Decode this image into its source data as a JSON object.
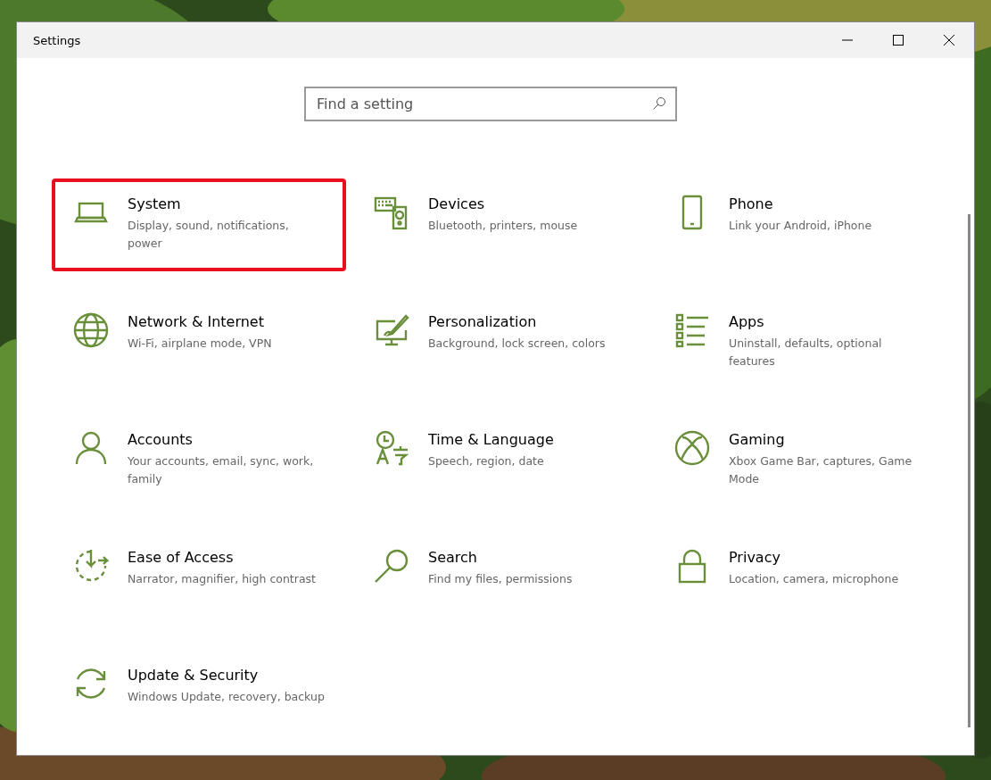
{
  "window": {
    "title": "Settings"
  },
  "search": {
    "placeholder": "Find a setting"
  },
  "tiles": [
    {
      "title": "System",
      "description": "Display, sound, notifications, power",
      "highlighted": true
    },
    {
      "title": "Devices",
      "description": "Bluetooth, printers, mouse",
      "highlighted": false
    },
    {
      "title": "Phone",
      "description": "Link your Android, iPhone",
      "highlighted": false
    },
    {
      "title": "Network & Internet",
      "description": "Wi-Fi, airplane mode, VPN",
      "highlighted": false
    },
    {
      "title": "Personalization",
      "description": "Background, lock screen, colors",
      "highlighted": false
    },
    {
      "title": "Apps",
      "description": "Uninstall, defaults, optional features",
      "highlighted": false
    },
    {
      "title": "Accounts",
      "description": "Your accounts, email, sync, work, family",
      "highlighted": false
    },
    {
      "title": "Time & Language",
      "description": "Speech, region, date",
      "highlighted": false
    },
    {
      "title": "Gaming",
      "description": "Xbox Game Bar, captures, Game Mode",
      "highlighted": false
    },
    {
      "title": "Ease of Access",
      "description": "Narrator, magnifier, high contrast",
      "highlighted": false
    },
    {
      "title": "Search",
      "description": "Find my files, permissions",
      "highlighted": false
    },
    {
      "title": "Privacy",
      "description": "Location, camera, microphone",
      "highlighted": false
    },
    {
      "title": "Update & Security",
      "description": "Windows Update, recovery, backup",
      "highlighted": false
    }
  ]
}
